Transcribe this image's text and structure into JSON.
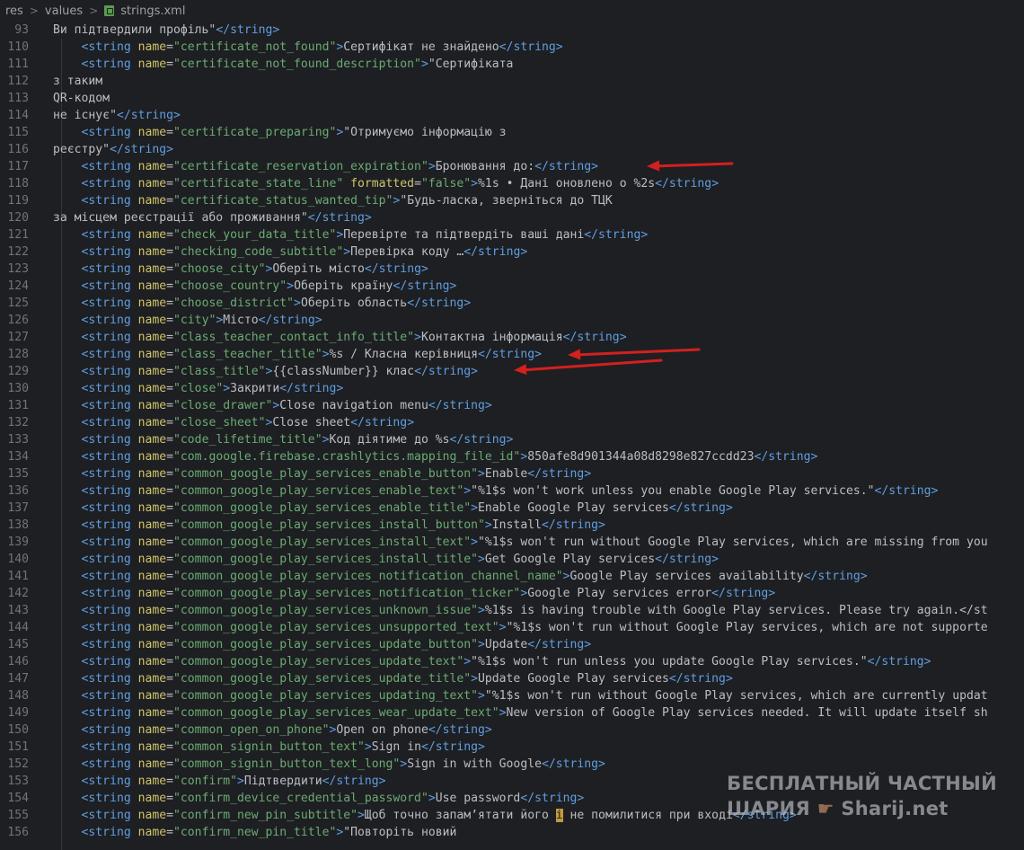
{
  "breadcrumb": [
    "res",
    "values",
    "strings.xml"
  ],
  "lines": [
    {
      "n": 93,
      "indent": false,
      "text": "Ви підтвердили профіль\"",
      "close": true
    },
    {
      "n": 110,
      "indent": true,
      "name": "certificate_not_found",
      "text": "Сертифікат не знайдено",
      "close": true
    },
    {
      "n": 111,
      "indent": true,
      "name": "certificate_not_found_description",
      "text": "\"Сертифіката",
      "close": false
    },
    {
      "n": 112,
      "indent": false,
      "text": "з таким",
      "close": false
    },
    {
      "n": 113,
      "indent": false,
      "text": "QR-кодом",
      "close": false
    },
    {
      "n": 114,
      "indent": false,
      "text": "не існує\"",
      "close": true
    },
    {
      "n": 115,
      "indent": true,
      "name": "certificate_preparing",
      "text": "\"Отримуємо інформацію з",
      "close": false
    },
    {
      "n": 116,
      "indent": false,
      "text": "реєстру\"",
      "close": true
    },
    {
      "n": 117,
      "indent": true,
      "name": "certificate_reservation_expiration",
      "text": "Бронювання до:",
      "close": true
    },
    {
      "n": 118,
      "indent": true,
      "name": "certificate_state_line",
      "formatted": "false",
      "text": "%1s • Дані оновлено о %2s",
      "close": true
    },
    {
      "n": 119,
      "indent": true,
      "name": "certificate_status_wanted_tip",
      "text": "\"Будь-ласка, зверніться до ТЦК",
      "close": false
    },
    {
      "n": 120,
      "indent": false,
      "text": "за місцем реєстрації або проживання\"",
      "close": true
    },
    {
      "n": 121,
      "indent": true,
      "name": "check_your_data_title",
      "text": "Перевірте та підтвердіть ваші дані",
      "close": true
    },
    {
      "n": 122,
      "indent": true,
      "name": "checking_code_subtitle",
      "text": "Перевірка коду …",
      "close": true
    },
    {
      "n": 123,
      "indent": true,
      "name": "choose_city",
      "text": "Оберіть місто",
      "close": true
    },
    {
      "n": 124,
      "indent": true,
      "name": "choose_country",
      "text": "Оберіть країну",
      "close": true
    },
    {
      "n": 125,
      "indent": true,
      "name": "choose_district",
      "text": "Оберіть область",
      "close": true
    },
    {
      "n": 126,
      "indent": true,
      "name": "city",
      "text": "Місто",
      "close": true
    },
    {
      "n": 127,
      "indent": true,
      "name": "class_teacher_contact_info_title",
      "text": "Контактна інформація",
      "close": true
    },
    {
      "n": 128,
      "indent": true,
      "name": "class_teacher_title",
      "text": "%s / Класна керівниця",
      "close": true
    },
    {
      "n": 129,
      "indent": true,
      "name": "class_title",
      "text": "{{classNumber}} клас",
      "close": true
    },
    {
      "n": 130,
      "indent": true,
      "name": "close",
      "text": "Закрити",
      "close": true
    },
    {
      "n": 131,
      "indent": true,
      "name": "close_drawer",
      "text": "Close navigation menu",
      "close": true
    },
    {
      "n": 132,
      "indent": true,
      "name": "close_sheet",
      "text": "Close sheet",
      "close": true
    },
    {
      "n": 133,
      "indent": true,
      "name": "code_lifetime_title",
      "text": "Код діятиме до %s",
      "close": true
    },
    {
      "n": 134,
      "indent": true,
      "name": "com.google.firebase.crashlytics.mapping_file_id",
      "text": "850afe8d901344a08d8298e827ccdd23",
      "close": true
    },
    {
      "n": 135,
      "indent": true,
      "name": "common_google_play_services_enable_button",
      "text": "Enable",
      "close": true
    },
    {
      "n": 136,
      "indent": true,
      "name": "common_google_play_services_enable_text",
      "text": "\"%1$s won't work unless you enable Google Play services.\"",
      "close": true
    },
    {
      "n": 137,
      "indent": true,
      "name": "common_google_play_services_enable_title",
      "text": "Enable Google Play services",
      "close": true
    },
    {
      "n": 138,
      "indent": true,
      "name": "common_google_play_services_install_button",
      "text": "Install",
      "close": true
    },
    {
      "n": 139,
      "indent": true,
      "name": "common_google_play_services_install_text",
      "text": "\"%1$s won't run without Google Play services, which are missing from you",
      "close": false
    },
    {
      "n": 140,
      "indent": true,
      "name": "common_google_play_services_install_title",
      "text": "Get Google Play services",
      "close": true
    },
    {
      "n": 141,
      "indent": true,
      "name": "common_google_play_services_notification_channel_name",
      "text": "Google Play services availability",
      "close": true
    },
    {
      "n": 142,
      "indent": true,
      "name": "common_google_play_services_notification_ticker",
      "text": "Google Play services error",
      "close": true
    },
    {
      "n": 143,
      "indent": true,
      "name": "common_google_play_services_unknown_issue",
      "text": "%1$s is having trouble with Google Play services. Please try again.</st",
      "close": false
    },
    {
      "n": 144,
      "indent": true,
      "name": "common_google_play_services_unsupported_text",
      "text": "\"%1$s won't run without Google Play services, which are not supporte",
      "close": false
    },
    {
      "n": 145,
      "indent": true,
      "name": "common_google_play_services_update_button",
      "text": "Update",
      "close": true
    },
    {
      "n": 146,
      "indent": true,
      "name": "common_google_play_services_update_text",
      "text": "\"%1$s won't run unless you update Google Play services.\"",
      "close": true
    },
    {
      "n": 147,
      "indent": true,
      "name": "common_google_play_services_update_title",
      "text": "Update Google Play services",
      "close": true
    },
    {
      "n": 148,
      "indent": true,
      "name": "common_google_play_services_updating_text",
      "text": "\"%1$s won't run without Google Play services, which are currently updat",
      "close": false
    },
    {
      "n": 149,
      "indent": true,
      "name": "common_google_play_services_wear_update_text",
      "text": "New version of Google Play services needed. It will update itself sh",
      "close": false
    },
    {
      "n": 150,
      "indent": true,
      "name": "common_open_on_phone",
      "text": "Open on phone",
      "close": true
    },
    {
      "n": 151,
      "indent": true,
      "name": "common_signin_button_text",
      "text": "Sign in",
      "close": true
    },
    {
      "n": 152,
      "indent": true,
      "name": "common_signin_button_text_long",
      "text": "Sign in with Google",
      "close": true
    },
    {
      "n": 153,
      "indent": true,
      "name": "confirm",
      "text": "Підтвердити",
      "close": true
    },
    {
      "n": 154,
      "indent": true,
      "name": "confirm_device_credential_password",
      "text": "Use password",
      "close": true
    },
    {
      "n": 155,
      "indent": true,
      "name": "confirm_new_pin_subtitle",
      "text": "Щоб точно запам’ятати його ! не помилитися при вході",
      "close": true
    },
    {
      "n": 156,
      "indent": true,
      "name": "confirm_new_pin_title",
      "text": "\"Повторіть новий",
      "close": false
    }
  ],
  "watermark": {
    "line1": "БЕСПЛАТНЫЙ ЧАСТНЫЙ",
    "line2a": "ШАРИЯ",
    "line2b": "Sharij.net"
  },
  "colors": {
    "background": "#1e1f22",
    "arrow": "#d3201f"
  }
}
